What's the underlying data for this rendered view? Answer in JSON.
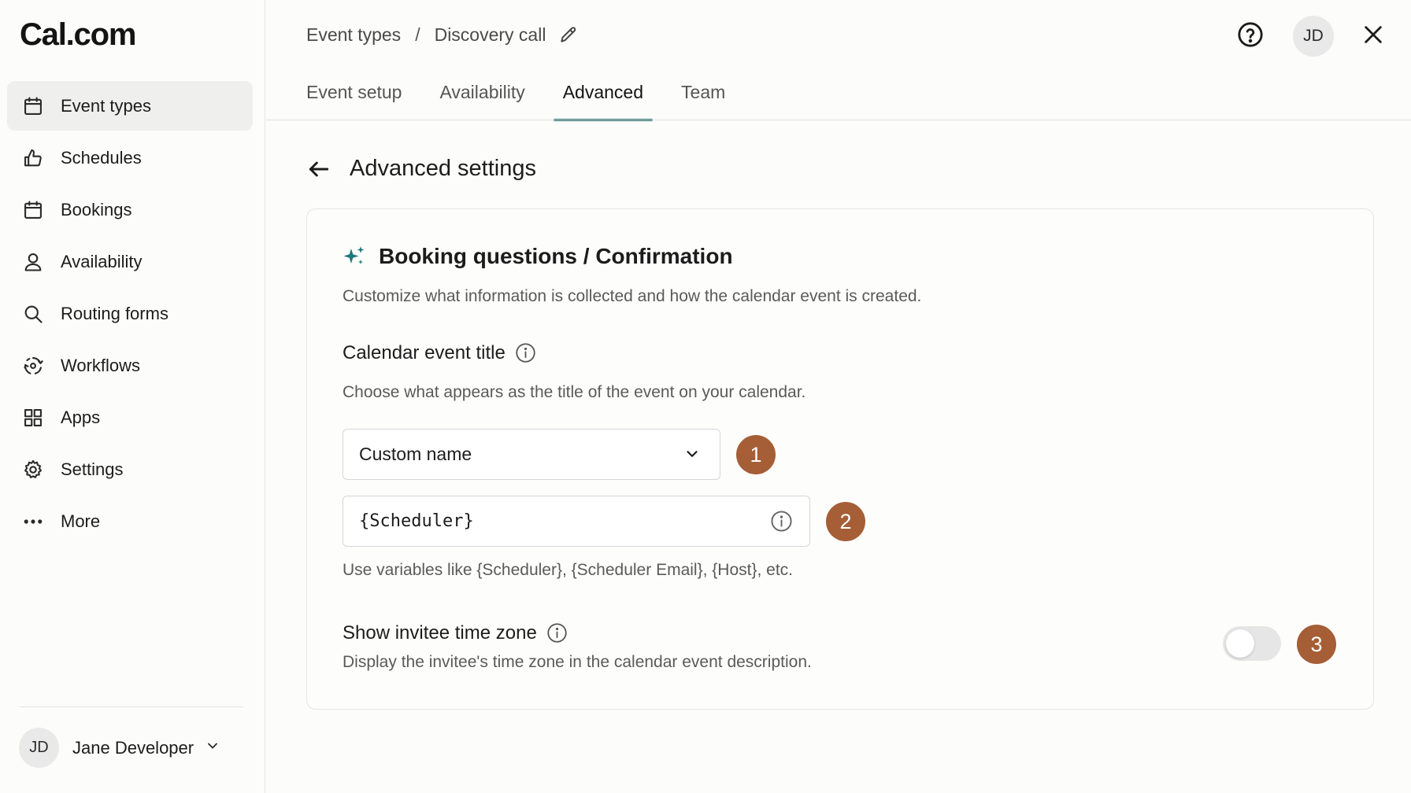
{
  "app": {
    "logo": "Cal.com"
  },
  "sidebar": {
    "items": [
      {
        "label": "Event types",
        "icon": "calendar-icon",
        "active": true
      },
      {
        "label": "Schedules",
        "icon": "hand-thumbs-up-icon",
        "active": false
      },
      {
        "label": "Bookings",
        "icon": "calendar-icon",
        "active": false
      },
      {
        "label": "Availability",
        "icon": "user-icon",
        "active": false
      },
      {
        "label": "Routing forms",
        "icon": "search-icon",
        "active": false
      },
      {
        "label": "Workflows",
        "icon": "workflow-icon",
        "active": false
      },
      {
        "label": "Apps",
        "icon": "grid-icon",
        "active": false
      },
      {
        "label": "Settings",
        "icon": "gear-icon",
        "active": false
      },
      {
        "label": "More",
        "icon": "more-dots-icon",
        "active": false
      }
    ],
    "user": {
      "initials": "JD",
      "name": "Jane Developer"
    }
  },
  "header": {
    "breadcrumb": {
      "parent": "Event types",
      "separator": "/",
      "current": "Discovery call"
    },
    "avatar_initials": "JD"
  },
  "tabs": [
    {
      "label": "Event setup",
      "active": false
    },
    {
      "label": "Availability",
      "active": false
    },
    {
      "label": "Advanced",
      "active": true
    },
    {
      "label": "Team",
      "active": false
    }
  ],
  "page": {
    "title": "Advanced settings"
  },
  "section": {
    "title": "Booking questions / Confirmation",
    "description": "Customize what information is collected and how the calendar event is created.",
    "calendar_title": {
      "label": "Calendar event title",
      "description": "Choose what appears as the title of the event on your calendar.",
      "select_value": "Custom name",
      "input_value": "{Scheduler}",
      "hint": "Use variables like {Scheduler}, {Scheduler Email}, {Host}, etc."
    },
    "timezone": {
      "label": "Show invitee time zone",
      "description": "Display the invitee's time zone in the calendar event description.",
      "enabled": false
    }
  },
  "markers": [
    "1",
    "2",
    "3"
  ],
  "colors": {
    "accent": "#1c6b6a",
    "sparkle": "#1f7a7a",
    "marker": "#a65e36"
  }
}
